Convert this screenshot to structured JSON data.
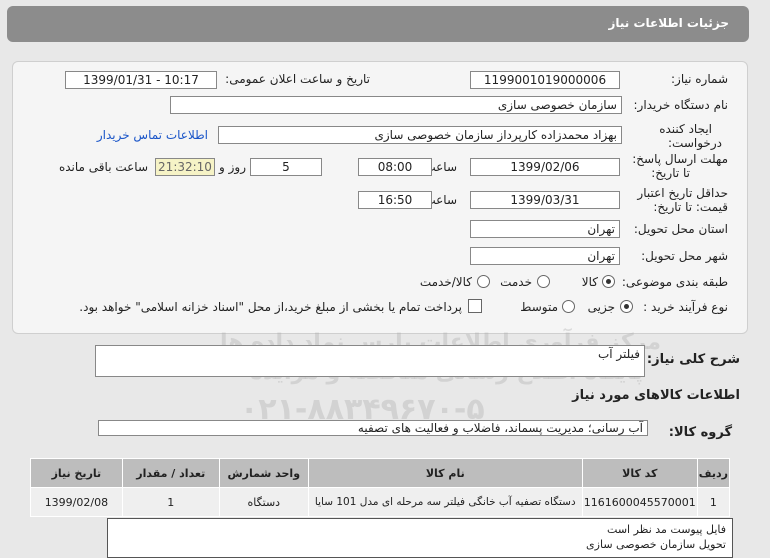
{
  "header": {
    "title": "جزئیات اطلاعات نیاز"
  },
  "form": {
    "need_number_label": "شماره نیاز:",
    "need_number": "1199001019000006",
    "announce_label": "تاریخ و ساعت اعلان عمومی:",
    "announce_value": "1399/01/31 - 10:17",
    "buyer_org_label": "نام دستگاه خریدار:",
    "buyer_org": "سازمان خصوصی سازی",
    "creator_label_1": "ایجاد کننده",
    "creator_label_2": "درخواست:",
    "creator": "بهزاد محمدزاده کارپرداز سازمان خصوصی سازی",
    "buyer_contact_link": "اطلاعات تماس خریدار",
    "deadline_label_1": "مهلت ارسال پاسخ:",
    "deadline_label_2": "تا تاریخ:",
    "deadline_date": "1399/02/06",
    "time_label": "ساعت",
    "deadline_time": "08:00",
    "days": "5",
    "days_label": "روز و",
    "remaining_time": "21:32:10",
    "remaining_label": "ساعت باقی مانده",
    "validity_label_1": "حداقل تاریخ اعتبار",
    "validity_label_2": "قیمت: تا تاریخ:",
    "validity_date": "1399/03/31",
    "validity_time": "16:50",
    "province_label": "استان محل تحویل:",
    "province": "تهران",
    "city_label": "شهر محل تحویل:",
    "city": "تهران",
    "category_label": "طبقه بندی موضوعی:",
    "category_options": [
      "کالا",
      "خدمت",
      "کالا/خدمت"
    ],
    "purchase_type_label": "نوع فرآیند خرید :",
    "purchase_options": [
      "جزیی",
      "متوسط"
    ],
    "payment_note": "پرداخت تمام یا بخشی از مبلغ خرید،از محل \"اسناد خزانه اسلامی\" خواهد بود."
  },
  "summary": {
    "label": "شرح کلی نیاز:",
    "value": "فیلتر آب"
  },
  "goods_info_title": "اطلاعات کالاهای مورد نیاز",
  "goods_group": {
    "label": "گروه کالا:",
    "value": "آب رسانی؛ مدیریت پسماند، فاضلاب و فعالیت های تصفیه"
  },
  "table": {
    "headers": [
      "ردیف",
      "کد کالا",
      "نام کالا",
      "واحد شمارش",
      "تعداد / مقدار",
      "تاریخ نیاز"
    ],
    "rows": [
      [
        "1",
        "1161600045570001",
        "دستگاه تصفیه آب خانگی فیلتر سه مرحله ای مدل 101 سایا",
        "دستگاه",
        "1",
        "1399/02/08"
      ]
    ]
  },
  "notes": {
    "line1": "فایل پیوست مد نظر است",
    "line2": "تحویل سازمان خصوصی سازی"
  },
  "watermark": {
    "line1": "مرکز فرآوری اطلاعات پارس نماد داده ها",
    "line2": "پایگاه اطلاع رسانی مناقصه و مزایده",
    "line3": "۰۲۱-۸۸۳۴۹۶۷۰-۵"
  }
}
